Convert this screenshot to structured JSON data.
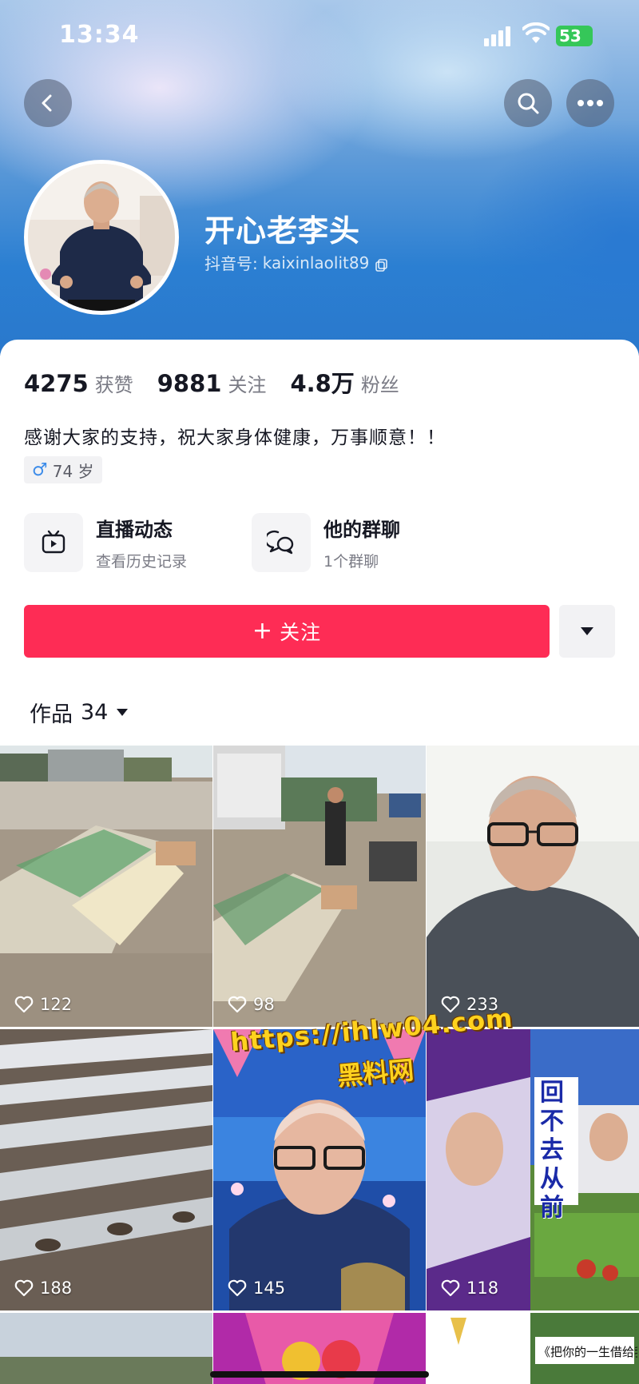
{
  "status_bar": {
    "time": "13:34",
    "battery": "53"
  },
  "profile": {
    "name": "开心老李头",
    "id_label": "抖音号:",
    "id_value": "kaixinlaolit89",
    "stats": [
      {
        "num": "4275",
        "label": "获赞"
      },
      {
        "num": "9881",
        "label": "关注"
      },
      {
        "num": "4.8万",
        "label": "粉丝"
      }
    ],
    "bio": "感谢大家的支持，祝大家身体健康，万事顺意！！",
    "age_tag": "74 岁"
  },
  "features": {
    "live": {
      "title": "直播动态",
      "sub": "查看历史记录"
    },
    "group": {
      "title": "他的群聊",
      "sub": "1个群聊"
    }
  },
  "actions": {
    "follow_label": "关注"
  },
  "works": {
    "label": "作品",
    "count": "34"
  },
  "videos": [
    {
      "likes": "122"
    },
    {
      "likes": "98"
    },
    {
      "likes": "233"
    },
    {
      "likes": "188"
    },
    {
      "likes": "145"
    },
    {
      "likes": "118"
    }
  ],
  "watermark": {
    "url": "https://ihlw04.com",
    "site": "黑料网"
  },
  "overlay_text": {
    "poster_a": "回不去从前",
    "poster_b": "《把你的一生借给我"
  },
  "colors": {
    "follow_red": "#fe2c55",
    "banner_blue": "#2b7fd2"
  }
}
